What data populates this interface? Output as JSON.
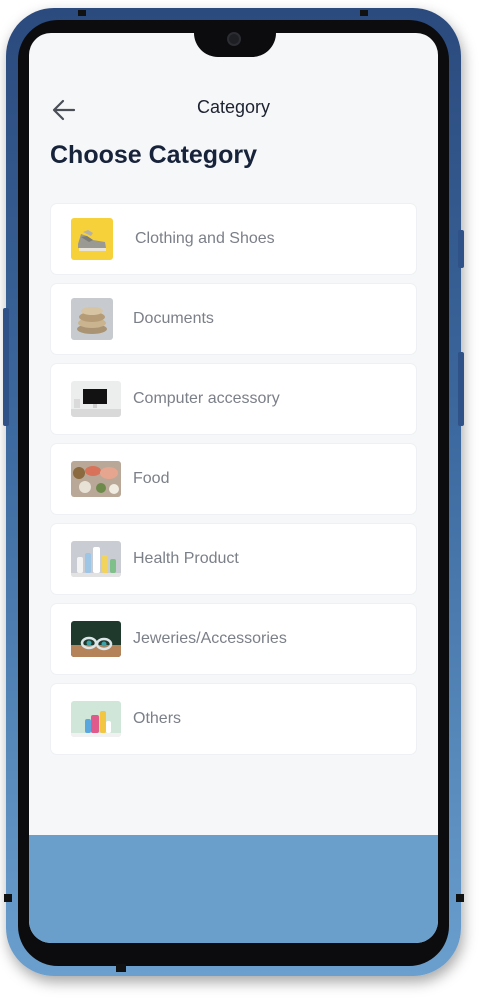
{
  "header": {
    "title": "Category",
    "back_icon": "arrow-left-icon"
  },
  "page": {
    "title": "Choose Category"
  },
  "categories": [
    {
      "label": "Clothing and Shoes",
      "icon": "shoes-thumbnail"
    },
    {
      "label": "Documents",
      "icon": "documents-thumbnail"
    },
    {
      "label": "Computer accessory",
      "icon": "computer-thumbnail"
    },
    {
      "label": "Food",
      "icon": "food-thumbnail"
    },
    {
      "label": "Health Product",
      "icon": "health-product-thumbnail"
    },
    {
      "label": "Jeweries/Accessories",
      "icon": "jewelry-thumbnail"
    },
    {
      "label": "Others",
      "icon": "others-thumbnail"
    }
  ],
  "colors": {
    "screen_background": "#f6f7f9",
    "card_background": "#ffffff",
    "title_text": "#17233a",
    "label_text": "#7b7f88",
    "bottom_band": "#6a9fcb",
    "phone_frame": "#3d6aa0"
  }
}
